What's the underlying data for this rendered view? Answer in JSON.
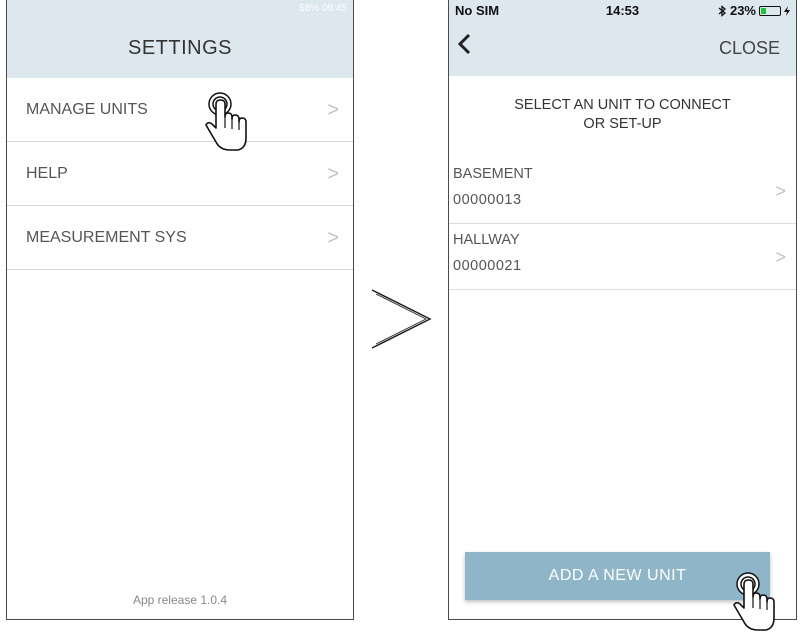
{
  "left_screen": {
    "status_text": "58% 09:45",
    "header_title": "SETTINGS",
    "menu_items": [
      {
        "label": "MANAGE UNITS",
        "chevron": ">"
      },
      {
        "label": "HELP",
        "chevron": ">"
      },
      {
        "label": "MEASUREMENT SYS",
        "chevron": ">"
      }
    ],
    "footer": "App release 1.0.4"
  },
  "right_screen": {
    "status": {
      "carrier": "No SIM",
      "time": "14:53",
      "battery": "23%",
      "bluetooth_icon": "bluetooth-icon"
    },
    "nav": {
      "back_label": "<",
      "close_label": "CLOSE"
    },
    "instruction_line1": "SELECT AN UNIT TO CONNECT",
    "instruction_line2": "OR SET-UP",
    "units": [
      {
        "name": "BASEMENT",
        "serial": "00000013",
        "chevron": ">"
      },
      {
        "name": "HALLWAY",
        "serial": "00000021",
        "chevron": ">"
      }
    ],
    "add_button": "ADD A NEW UNIT"
  },
  "colors": {
    "header_bg": "#dce7ee",
    "button_bg": "#8fb6c8",
    "battery_green": "#26c13a"
  }
}
